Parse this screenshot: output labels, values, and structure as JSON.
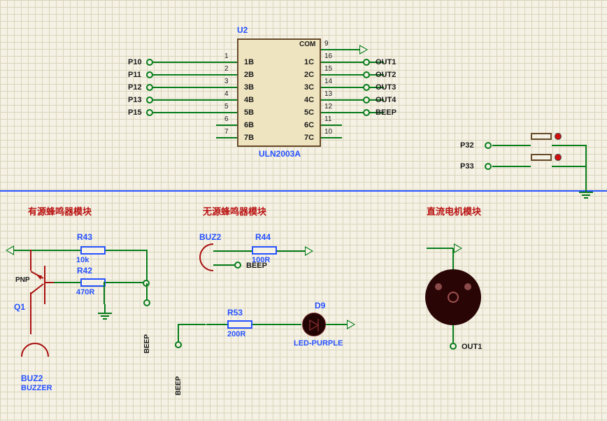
{
  "ic": {
    "ref": "U2",
    "part": "ULN2003A",
    "com": "COM",
    "left": [
      {
        "n": "1",
        "name": "1B",
        "net": "P10"
      },
      {
        "n": "2",
        "name": "2B",
        "net": "P11"
      },
      {
        "n": "3",
        "name": "3B",
        "net": "P12"
      },
      {
        "n": "4",
        "name": "4B",
        "net": "P13"
      },
      {
        "n": "5",
        "name": "5B",
        "net": "P15"
      },
      {
        "n": "6",
        "name": "6B",
        "net": ""
      },
      {
        "n": "7",
        "name": "7B",
        "net": ""
      }
    ],
    "right": [
      {
        "n": "9",
        "name": "",
        "net": ""
      },
      {
        "n": "16",
        "name": "1C",
        "net": "OUT1"
      },
      {
        "n": "15",
        "name": "2C",
        "net": "OUT2"
      },
      {
        "n": "14",
        "name": "3C",
        "net": "OUT3"
      },
      {
        "n": "13",
        "name": "4C",
        "net": "OUT4"
      },
      {
        "n": "12",
        "name": "5C",
        "net": "BEEP"
      },
      {
        "n": "11",
        "name": "6C",
        "net": ""
      },
      {
        "n": "10",
        "name": "7C",
        "net": ""
      }
    ]
  },
  "buttons": {
    "p32": "P32",
    "p33": "P33"
  },
  "section1": {
    "title": "有源蜂鸣器模块",
    "r43": {
      "ref": "R43",
      "val": "10k"
    },
    "r42": {
      "ref": "R42",
      "val": "470R"
    },
    "q1": {
      "ref": "Q1",
      "type": "PNP"
    },
    "buz": {
      "ref": "BUZ2",
      "type": "BUZZER"
    },
    "beep1": "BEEP",
    "beep2": "BEEP"
  },
  "section2": {
    "title": "无源蜂鸣器模块",
    "buz2": "BUZ2",
    "r44": {
      "ref": "R44",
      "val": "100R"
    },
    "beep": "BEEP",
    "r53": {
      "ref": "R53",
      "val": "200R"
    },
    "d9": {
      "ref": "D9",
      "type": "LED-PURPLE"
    }
  },
  "section3": {
    "title": "直流电机模块",
    "out1": "OUT1"
  }
}
